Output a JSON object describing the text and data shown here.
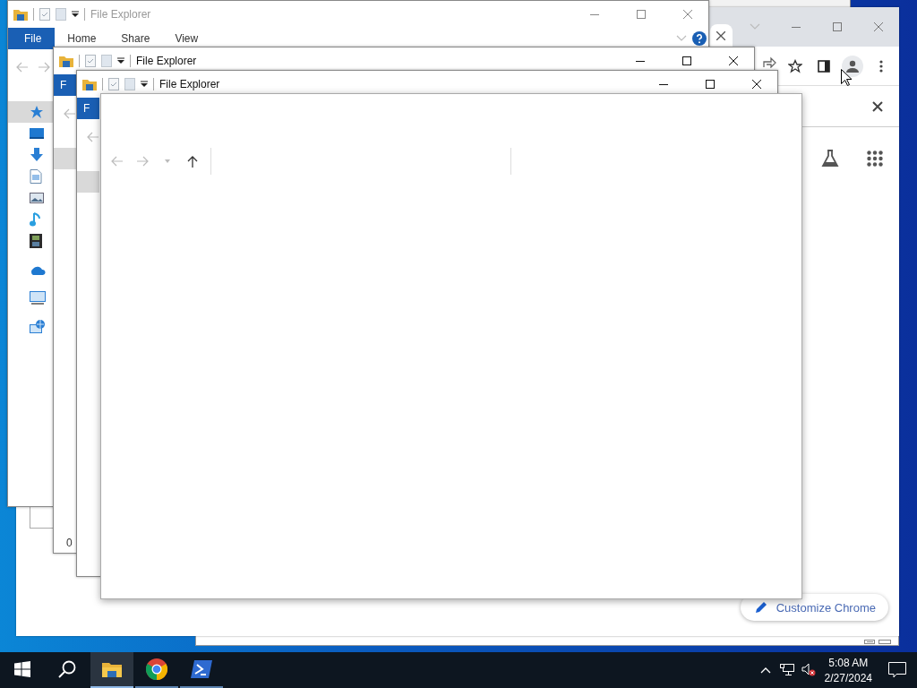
{
  "chrome": {
    "customize_button": "Customize Chrome"
  },
  "explorer_windows": [
    {
      "title": "File Explorer",
      "active": false,
      "ribbon_tabs": [
        {
          "label": "File",
          "kind": "file-menu"
        },
        {
          "label": "Home",
          "kind": "tab"
        },
        {
          "label": "Share",
          "kind": "tab"
        },
        {
          "label": "View",
          "kind": "tab"
        }
      ],
      "nav_items": [
        {
          "kind": "star",
          "selected": true
        },
        {
          "kind": "desktop",
          "selected": false
        },
        {
          "kind": "download",
          "selected": false
        },
        {
          "kind": "document",
          "selected": false
        },
        {
          "kind": "picture",
          "selected": false
        },
        {
          "kind": "music",
          "selected": false
        },
        {
          "kind": "video",
          "selected": false
        },
        {
          "kind": "cloud",
          "selected": false
        },
        {
          "kind": "pc",
          "selected": false
        },
        {
          "kind": "network",
          "selected": false
        }
      ]
    },
    {
      "title": "File Explorer",
      "active": true,
      "ribbon_tabs": [
        {
          "label": "F",
          "kind": "file-menu"
        }
      ],
      "nav_items": [
        {
          "kind": "blank",
          "selected": true
        }
      ],
      "status": "0"
    },
    {
      "title": "File Explorer",
      "active": true,
      "ribbon_tabs": [
        {
          "label": "F",
          "kind": "file-menu"
        }
      ],
      "nav_items": [
        {
          "kind": "blank",
          "selected": true
        }
      ]
    }
  ],
  "taskbar": {
    "apps": [
      {
        "kind": "explorer",
        "selected": true
      },
      {
        "kind": "chrome",
        "selected": false
      },
      {
        "kind": "powershell",
        "selected": false
      }
    ],
    "clock": {
      "time": "5:08 AM",
      "date": "2/27/2024"
    }
  }
}
